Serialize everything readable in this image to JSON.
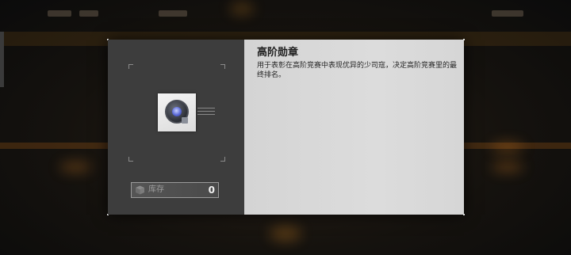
{
  "item": {
    "name": "高阶勋章",
    "description": "用于表彰在高阶竞赛中表现优异的少司寇，决定高阶竞赛里的最终排名。",
    "icon": "medal-icon"
  },
  "inventory": {
    "label": "库存",
    "count": "0",
    "icon": "box-icon"
  },
  "colors": {
    "left_panel": "#3d3d3d",
    "right_panel": "#d9d9d9",
    "title_text": "#1e1e1e",
    "stock_label": "#9c9c9c",
    "stock_count": "#f0f0f0"
  }
}
